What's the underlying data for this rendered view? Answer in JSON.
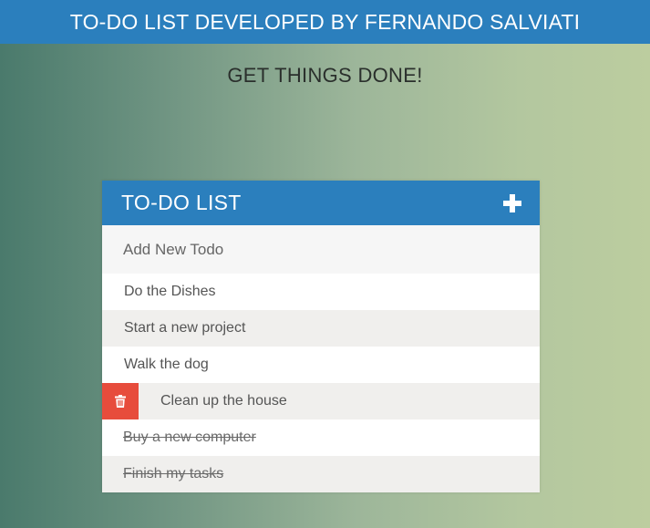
{
  "header": {
    "title": "TO-DO LIST DEVELOPED BY FERNANDO SALVIATI"
  },
  "tagline": "GET THINGS DONE!",
  "panel": {
    "title": "TO-DO LIST",
    "add_icon": "plus-icon",
    "new_todo_placeholder": "Add New Todo",
    "delete_icon": "trash-icon",
    "colors": {
      "header": "#2b7fbd",
      "delete": "#e74c3c"
    },
    "todos": [
      {
        "text": "Do the Dishes",
        "completed": false,
        "hovered": false
      },
      {
        "text": "Start a new project",
        "completed": false,
        "hovered": false
      },
      {
        "text": "Walk the dog",
        "completed": false,
        "hovered": false
      },
      {
        "text": "Clean up the house",
        "completed": false,
        "hovered": true
      },
      {
        "text": "Buy a new computer",
        "completed": true,
        "hovered": false
      },
      {
        "text": "Finish my tasks",
        "completed": true,
        "hovered": false
      }
    ]
  }
}
